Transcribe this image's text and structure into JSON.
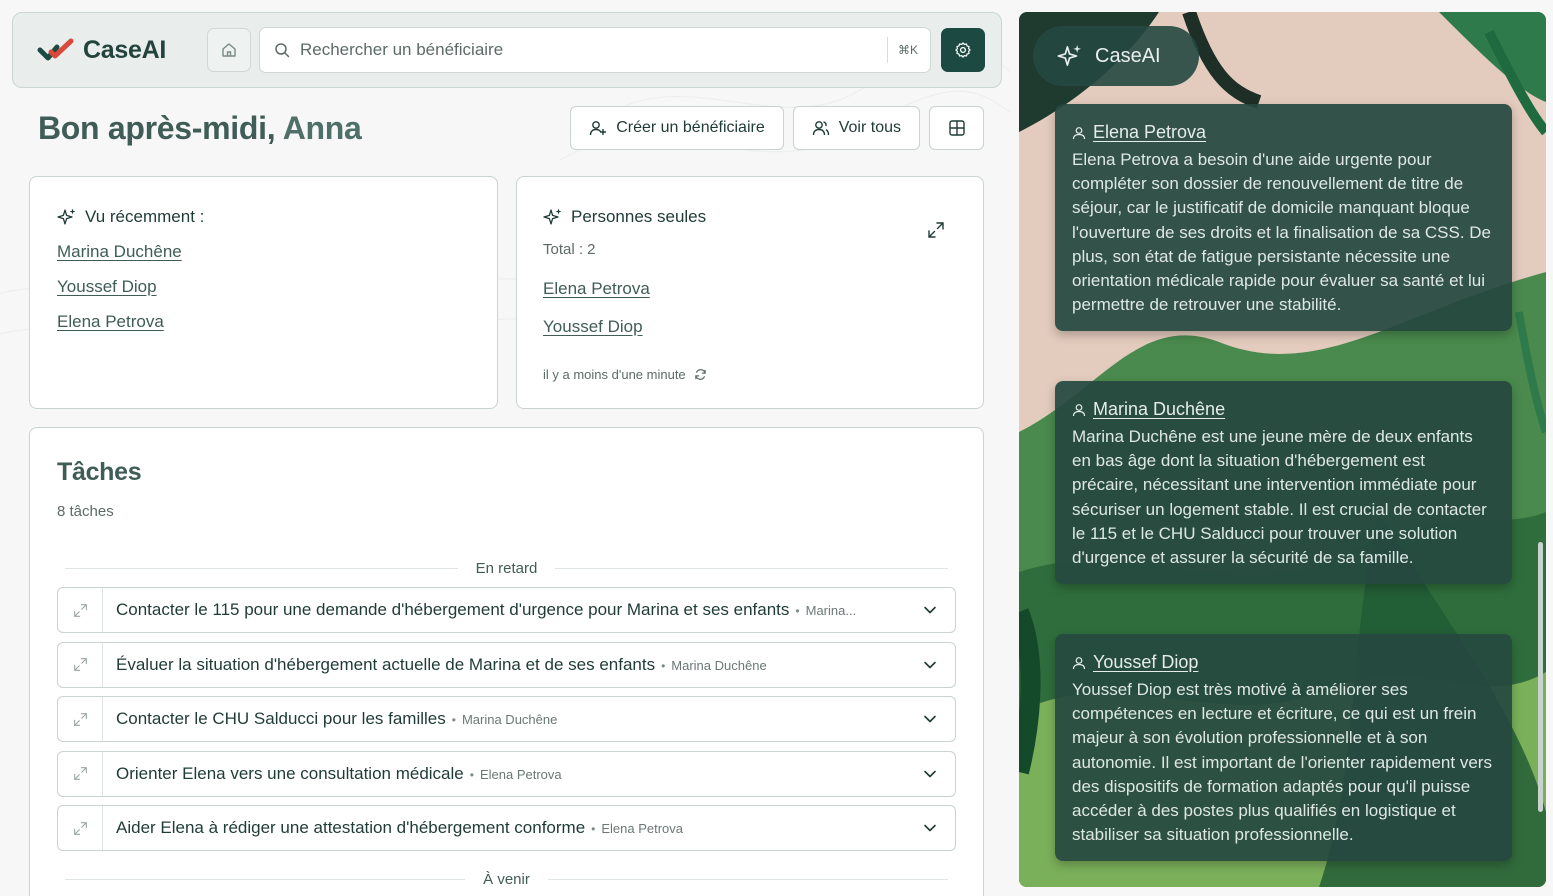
{
  "app": {
    "name": "CaseAI"
  },
  "topbar": {
    "search_placeholder": "Rechercher un bénéficiaire",
    "search_shortcut": "⌘K"
  },
  "greeting": {
    "prefix": "Bon après-midi,",
    "name": "Anna"
  },
  "actions": {
    "create_label": "Créer un bénéficiaire",
    "view_all_label": "Voir tous"
  },
  "recent": {
    "title": "Vu récemment :",
    "items": [
      "Marina Duchêne",
      "Youssef Diop",
      "Elena Petrova"
    ]
  },
  "alone": {
    "title": "Personnes seules",
    "total": "Total : 2",
    "items": [
      "Elena Petrova",
      "Youssef Diop"
    ],
    "updated": "il y a moins d'une minute"
  },
  "tasks": {
    "title": "Tâches",
    "count": "8 tâches",
    "section_overdue": "En retard",
    "section_upcoming": "À venir",
    "items": [
      {
        "title": "Contacter le 115 pour une demande d'hébergement d'urgence pour Marina et ses enfants",
        "person": "Marina..."
      },
      {
        "title": "Évaluer la situation d'hébergement actuelle de Marina et de ses enfants",
        "person": "Marina Duchêne"
      },
      {
        "title": "Contacter le CHU Salducci pour les familles",
        "person": "Marina Duchêne"
      },
      {
        "title": "Orienter Elena vers une consultation médicale",
        "person": "Elena Petrova"
      },
      {
        "title": "Aider Elena à rédiger une attestation d'hébergement conforme",
        "person": "Elena Petrova"
      }
    ]
  },
  "ai_panel": {
    "title": "CaseAI",
    "cards": [
      {
        "name": "Elena Petrova",
        "text": "Elena Petrova a besoin d'une aide urgente pour compléter son dossier de renouvellement de titre de séjour, car le justificatif de domicile manquant bloque l'ouverture de ses droits et la finalisation de sa CSS. De plus, son état de fatigue persistante nécessite une orientation médicale rapide pour évaluer sa santé et lui permettre de retrouver une stabilité."
      },
      {
        "name": "Marina Duchêne",
        "text": "Marina Duchêne est une jeune mère de deux enfants en bas âge dont la situation d'hébergement est précaire, nécessitant une intervention immédiate pour sécuriser un logement stable. Il est crucial de contacter le 115 et le CHU Salducci pour trouver une solution d'urgence et assurer la sécurité de sa famille."
      },
      {
        "name": "Youssef Diop",
        "text": "Youssef Diop est très motivé à améliorer ses compétences en lecture et écriture, ce qui est un frein majeur à son évolution professionnelle et à son autonomie. Il est important de l'orienter rapidement vers des dispositifs de formation adaptés pour qu'il puisse accéder à des postes plus qualifiés en logistique et stabiliser sa situation professionnelle."
      }
    ]
  },
  "colors": {
    "brand": "#1c4a42",
    "accent_red": "#d9483b",
    "panel_card": "#264840"
  }
}
